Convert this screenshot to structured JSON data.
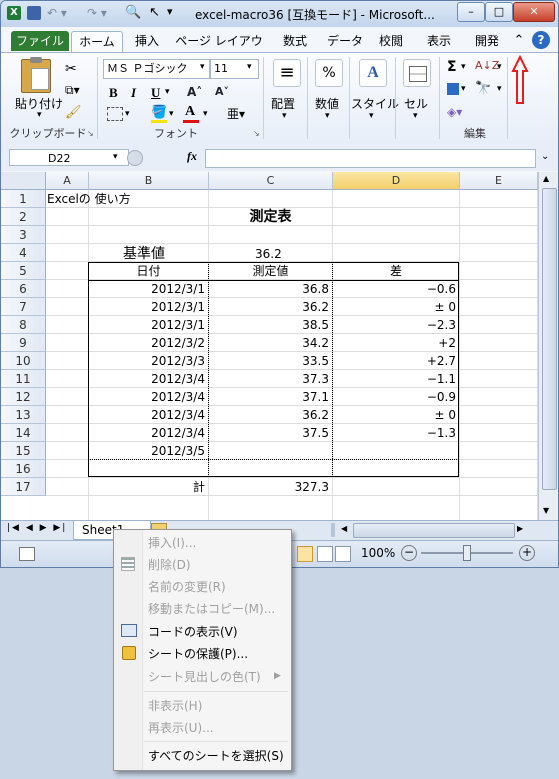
{
  "window": {
    "title": "excel-macro36 [互換モード] - Microsoft...",
    "min": "–",
    "restore": "□",
    "close": "✕"
  },
  "tabs": [
    "ファイル",
    "ホーム",
    "挿入",
    "ページ レイアウト",
    "数式",
    "データ",
    "校閲",
    "表示",
    "開発"
  ],
  "help": {
    "collapse": "⌃",
    "question": "?"
  },
  "ribbon": {
    "clipboard": {
      "paste": "貼り付け",
      "label": "クリップボード"
    },
    "font": {
      "name": "ＭＳ Ｐゴシック",
      "size": "11",
      "label": "フォント",
      "bold": "B",
      "italic": "I",
      "underline": "U",
      "grow": "A˄",
      "shrink": "A˅"
    },
    "align": {
      "label": "配置",
      "icon_text": "≡"
    },
    "number": {
      "label": "数値",
      "icon_text": "%"
    },
    "style": {
      "label": "スタイル",
      "icon_text": "A"
    },
    "cells": {
      "label": "セル"
    },
    "edit": {
      "label": "編集",
      "sigma": "Σ",
      "sort": "A↓Z"
    }
  },
  "formula_bar": {
    "namebox": "D22",
    "fx": "fx",
    "value": ""
  },
  "columns": [
    "A",
    "B",
    "C",
    "D",
    "E"
  ],
  "rows": [
    "1",
    "2",
    "3",
    "4",
    "5",
    "6",
    "7",
    "8",
    "9",
    "10",
    "11",
    "12",
    "13",
    "14",
    "15",
    "16",
    "17"
  ],
  "cells": {
    "a1": "Excelの 使い方",
    "title": "測定表",
    "base_label": "基準値",
    "base_value": "36.2",
    "h_date": "日付",
    "h_meas": "測定値",
    "h_diff": "差",
    "data": [
      {
        "date": "2012/3/1",
        "value": "36.8",
        "diff": "−0.6"
      },
      {
        "date": "2012/3/1",
        "value": "36.2",
        "diff": "± 0"
      },
      {
        "date": "2012/3/1",
        "value": "38.5",
        "diff": "−2.3"
      },
      {
        "date": "2012/3/2",
        "value": "34.2",
        "diff": "+2"
      },
      {
        "date": "2012/3/3",
        "value": "33.5",
        "diff": "+2.7"
      },
      {
        "date": "2012/3/4",
        "value": "37.3",
        "diff": "−1.1"
      },
      {
        "date": "2012/3/4",
        "value": "37.1",
        "diff": "−0.9"
      },
      {
        "date": "2012/3/4",
        "value": "36.2",
        "diff": "± 0"
      },
      {
        "date": "2012/3/4",
        "value": "37.5",
        "diff": "−1.3"
      },
      {
        "date": "2012/3/5",
        "value": "",
        "diff": ""
      }
    ],
    "total_label": "計",
    "total_value": "327.3"
  },
  "sheet_tab": "Sheet1",
  "status": {
    "zoom": "100%"
  },
  "context_menu": [
    {
      "label": "挿入(I)...",
      "disabled": true
    },
    {
      "label": "削除(D)",
      "disabled": true
    },
    {
      "label": "名前の変更(R)",
      "disabled": true
    },
    {
      "label": "移動またはコピー(M)...",
      "disabled": true
    },
    {
      "label": "コードの表示(V)",
      "disabled": false
    },
    {
      "label": "シートの保護(P)...",
      "disabled": false
    },
    {
      "label": "シート見出しの色(T)",
      "disabled": true
    },
    {
      "label": "非表示(H)",
      "disabled": true
    },
    {
      "label": "再表示(U)...",
      "disabled": true
    },
    {
      "label": "すべてのシートを選択(S)",
      "disabled": false
    }
  ],
  "colors": {
    "accent_file": "#2f7d32",
    "arrow_red": "#e02020",
    "selected_col": "#f7d87a"
  }
}
